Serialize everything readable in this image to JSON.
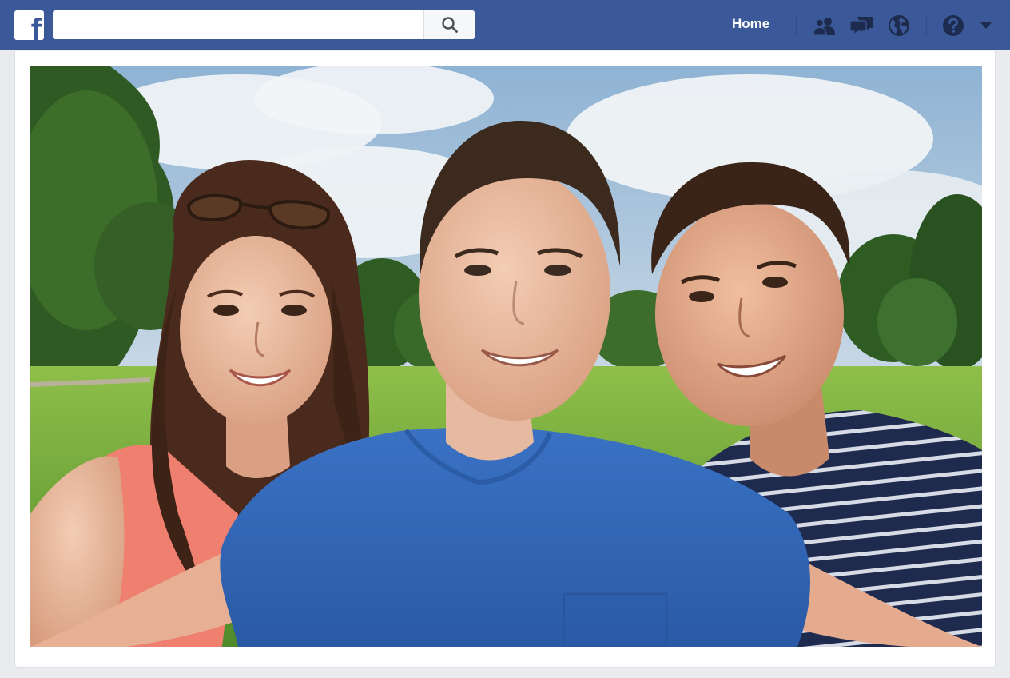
{
  "header": {
    "logo_letter": "f",
    "search": {
      "value": "",
      "placeholder": ""
    },
    "nav": {
      "home_label": "Home"
    }
  },
  "icons": {
    "logo": "facebook-logo",
    "search": "search-icon",
    "friends": "friend-requests-icon",
    "messages": "messages-icon",
    "notifications": "globe-notifications-icon",
    "help": "help-icon",
    "menu": "caret-down-icon"
  },
  "colors": {
    "brand_blue": "#3b5998",
    "page_background": "#e9ebee",
    "icon_dark": "#1d2b4e"
  },
  "post": {
    "photo_description_icon": "photo"
  }
}
